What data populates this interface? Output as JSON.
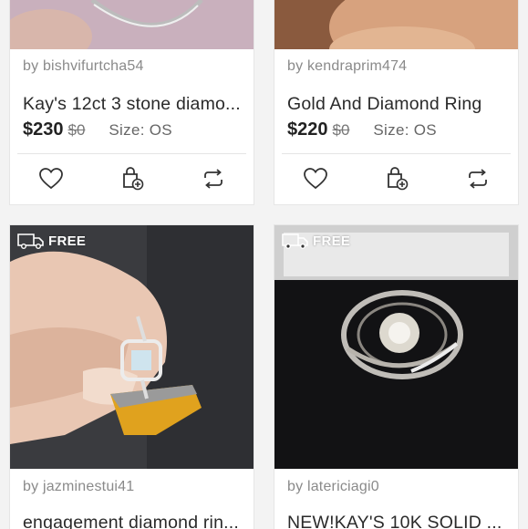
{
  "listings": [
    {
      "seller": "by bishvifurtcha54",
      "title": "Kay's 12ct 3 stone diamo...",
      "price": "$230",
      "original_price": "$0",
      "size": "Size: OS",
      "free_shipping": false
    },
    {
      "seller": "by kendraprim474",
      "title": "Gold And Diamond Ring",
      "price": "$220",
      "original_price": "$0",
      "size": "Size: OS",
      "free_shipping": false
    },
    {
      "seller": "by jazminestui41",
      "title": "engagement diamond rin...",
      "free_shipping": true,
      "badge_label": "FREE"
    },
    {
      "seller": "by latericiagi0",
      "title": "NEW!KAY'S 10K SOLID ...",
      "free_shipping": true,
      "badge_label": "FREE"
    }
  ],
  "actions": {
    "like_icon": "heart-icon",
    "bundle_icon": "bag-plus-icon",
    "share_icon": "share-icon"
  },
  "colors": {
    "background": "#f3f3f3",
    "card": "#ffffff",
    "text": "#2a2a2a",
    "muted": "#8a8a8a"
  }
}
